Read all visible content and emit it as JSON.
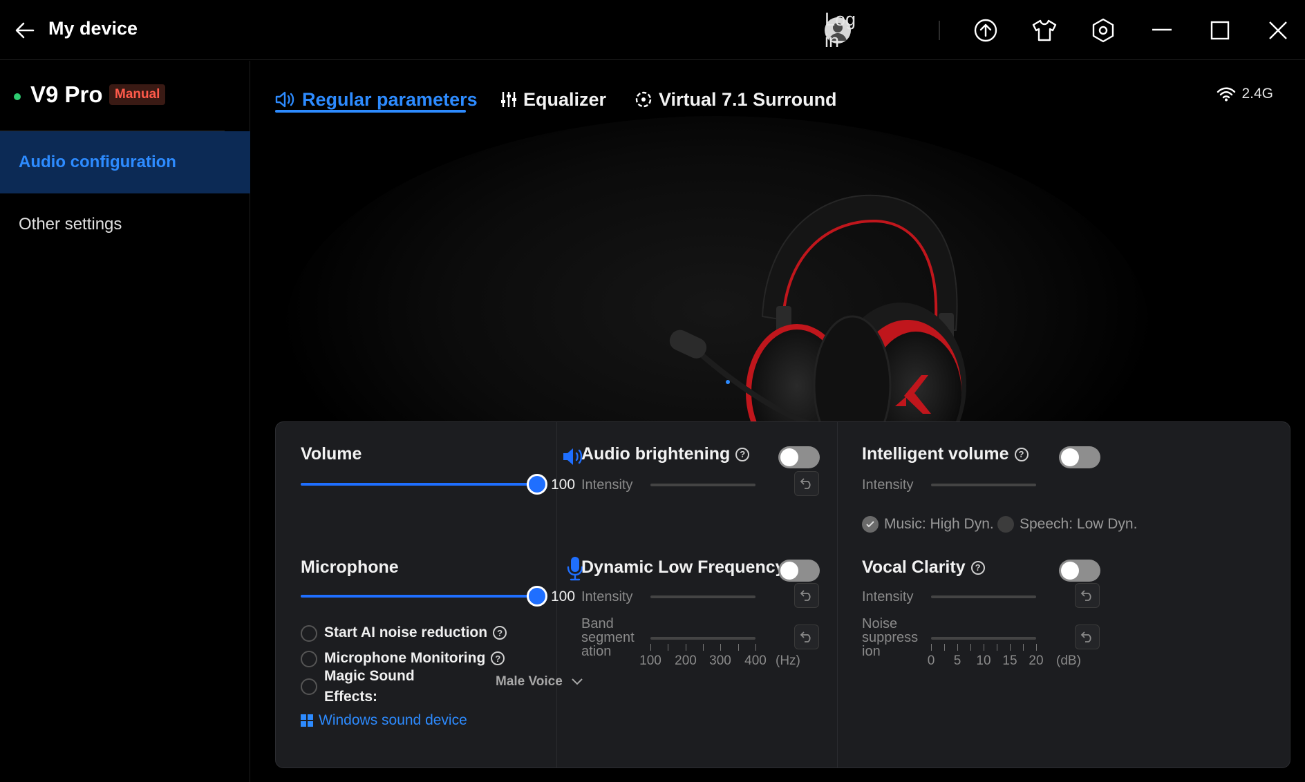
{
  "titlebar": {
    "title": "My device",
    "login_label": "Log in",
    "icons": [
      "back-arrow-icon",
      "user-avatar-icon",
      "upload-icon",
      "tshirt-icon",
      "settings-hexagon-icon",
      "minimize-icon",
      "maximize-icon",
      "close-icon"
    ]
  },
  "sidebar": {
    "device_name": "V9 Pro",
    "device_badge": "Manual",
    "status_color": "#2ecc71",
    "items": [
      {
        "label": "Audio configuration",
        "active": true
      },
      {
        "label": "Other settings",
        "active": false
      }
    ]
  },
  "tabs": [
    {
      "label": "Regular parameters",
      "active": true,
      "icon": "speaker-icon"
    },
    {
      "label": "Equalizer",
      "active": false,
      "icon": "sliders-icon"
    },
    {
      "label": "Virtual 7.1 Surround",
      "active": false,
      "icon": "surround-icon"
    }
  ],
  "connection": {
    "label": "2.4G",
    "icon": "wifi-icon"
  },
  "colors": {
    "accent": "#2d8bff",
    "panel": "#1c1d20",
    "badge_text": "#ff5a4a"
  },
  "volume": {
    "title": "Volume",
    "value": "100",
    "level": 100
  },
  "microphone": {
    "title": "Microphone",
    "value": "100",
    "level": 100,
    "options": [
      {
        "label": "Start AI noise reduction",
        "checked": false
      },
      {
        "label": "Microphone Monitoring",
        "checked": false
      }
    ],
    "magic_label_1": "Magic Sound",
    "magic_label_2": "Effects:",
    "magic_value": "Male Voice",
    "windows_link": "Windows sound device"
  },
  "audio_brightening": {
    "title": "Audio brightening",
    "enabled": false,
    "intensity_label": "Intensity"
  },
  "dynamic_low_frequency": {
    "title": "Dynamic Low Frequency",
    "enabled": false,
    "intensity_label": "Intensity",
    "band_label_1": "Band",
    "band_label_2": "segment",
    "band_label_3": "ation",
    "ticks": [
      "100",
      "200",
      "300",
      "400"
    ],
    "unit": "(Hz)"
  },
  "intelligent_volume": {
    "title": "Intelligent volume",
    "enabled": false,
    "intensity_label": "Intensity",
    "mode_music": "Music: High Dyn.",
    "mode_speech": "Speech: Low Dyn.",
    "selected": "music"
  },
  "vocal_clarity": {
    "title": "Vocal Clarity",
    "enabled": false,
    "intensity_label": "Intensity",
    "noise_label_1": "Noise",
    "noise_label_2": "suppress",
    "noise_label_3": "ion",
    "ticks": [
      "0",
      "5",
      "10",
      "15",
      "20"
    ],
    "unit": "(dB)"
  }
}
